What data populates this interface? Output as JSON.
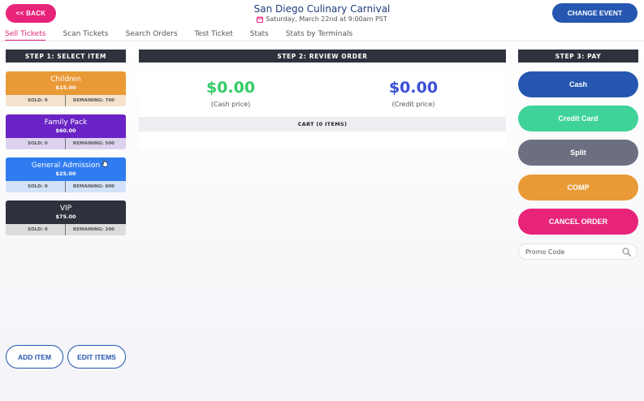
{
  "header": {
    "back_label": "<< BACK",
    "event_title": "San Diego Culinary Carnival",
    "event_date": "Saturday, March 22nd at 9:00am PST",
    "change_label": "CHANGE EVENT"
  },
  "tabs": [
    {
      "label": "Sell Tickets",
      "active": true
    },
    {
      "label": "Scan Tickets"
    },
    {
      "label": "Search Orders"
    },
    {
      "label": "Test Ticket"
    },
    {
      "label": "Stats"
    },
    {
      "label": "Stats by Terminals"
    }
  ],
  "step1": {
    "title": "STEP 1: SELECT ITEM",
    "items": [
      {
        "name": "Children",
        "price": "$15.00",
        "sold": "SOLD: 0",
        "remaining": "REMAINING: 700",
        "color": "#e99a37",
        "bottom": "#f5e2cc"
      },
      {
        "name": "Family Pack",
        "price": "$60.00",
        "sold": "SOLD: 0",
        "remaining": "REMAINING: 500",
        "color": "#6a23c4",
        "bottom": "#ddd2ee"
      },
      {
        "name": "General Admission",
        "price": "$25.00",
        "sold": "SOLD: 0",
        "remaining": "REMAINING: 800",
        "color": "#2f7cf0",
        "bottom": "#d2e2f8"
      },
      {
        "name": "VIP",
        "price": "$75.00",
        "sold": "SOLD: 0",
        "remaining": "REMAINING: 200",
        "color": "#2d323c",
        "bottom": "#dcdcdc"
      }
    ],
    "add_item_label": "ADD ITEM",
    "edit_items_label": "EDIT ITEMS"
  },
  "step2": {
    "title": "STEP 2: REVIEW ORDER",
    "cash_amount": "$0.00",
    "cash_label": "(Cash price)",
    "credit_amount": "$0.00",
    "credit_label": "(Credit price)",
    "cart_label": "CART (0 ITEMS)",
    "colors": {
      "cash": "#33cc66",
      "credit": "#3b4fd8"
    }
  },
  "step3": {
    "title": "STEP 3: PAY",
    "buttons": [
      {
        "label": "Cash",
        "color": "#2557b0"
      },
      {
        "label": "Credit Card",
        "color": "#3fd39a"
      },
      {
        "label": "Split",
        "color": "#6c6f80"
      },
      {
        "label": "COMP",
        "color": "#e99a37"
      },
      {
        "label": "CANCEL ORDER",
        "color": "#e8237a"
      }
    ],
    "promo_placeholder": "Promo Code"
  }
}
